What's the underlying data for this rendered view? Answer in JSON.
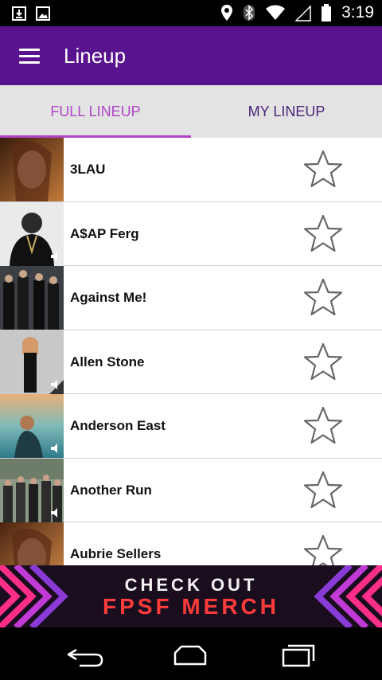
{
  "status_bar": {
    "time": "3:19",
    "icons": [
      "download-icon",
      "image-icon",
      "location-icon",
      "bluetooth-icon",
      "wifi-icon",
      "signal-icon",
      "battery-icon"
    ]
  },
  "app_bar": {
    "title": "Lineup",
    "color": "#5a138f"
  },
  "tabs": [
    {
      "label": "FULL LINEUP",
      "active": true
    },
    {
      "label": "MY LINEUP",
      "active": false
    }
  ],
  "artists": [
    {
      "name": "3LAU",
      "favorited": false
    },
    {
      "name": "A$AP Ferg",
      "favorited": false
    },
    {
      "name": "Against Me!",
      "favorited": false
    },
    {
      "name": "Allen Stone",
      "favorited": false
    },
    {
      "name": "Anderson East",
      "favorited": false
    },
    {
      "name": "Another Run",
      "favorited": false
    },
    {
      "name": "Aubrie Sellers",
      "favorited": false
    }
  ],
  "banner": {
    "line1": "CHECK OUT",
    "line2": "FPSF MERCH"
  },
  "nav_bar": {
    "icons": [
      "back-icon",
      "home-icon",
      "recents-icon"
    ]
  }
}
